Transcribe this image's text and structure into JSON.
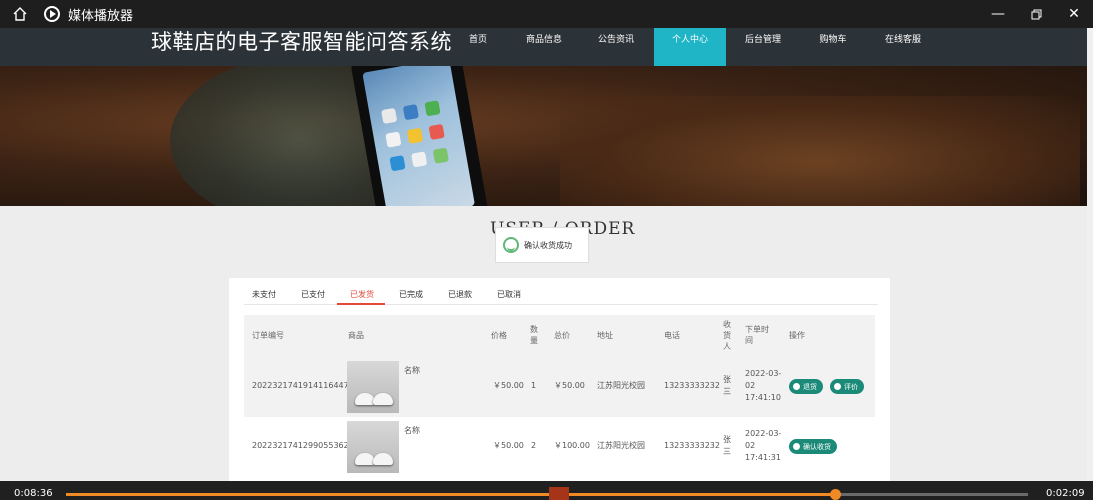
{
  "player": {
    "app_title": "媒体播放器",
    "current_time": "0:08:36",
    "remaining_time": "0:02:09",
    "progress_percent": 79.9
  },
  "site": {
    "title": "球鞋店的电子客服智能问答系统",
    "nav": [
      {
        "label": "首页"
      },
      {
        "label": "商品信息"
      },
      {
        "label": "公告资讯"
      },
      {
        "label": "个人中心"
      },
      {
        "label": "后台管理"
      },
      {
        "label": "购物车"
      },
      {
        "label": "在线客服"
      }
    ],
    "active_nav": "个人中心"
  },
  "toast": {
    "text": "确认收货成功"
  },
  "section_title": "USER / ORDER",
  "tabs": [
    "未支付",
    "已支付",
    "已发货",
    "已完成",
    "已退款",
    "已取消"
  ],
  "active_tab": "已发货",
  "table": {
    "headers": {
      "order_no": "订单编号",
      "goods": "商品",
      "price": "价格",
      "qty": "数量",
      "total": "总价",
      "address": "地址",
      "phone": "电话",
      "receiver": "收货人",
      "time": "下单时间",
      "action": "操作"
    },
    "rows": [
      {
        "order_no": "2022321741914116447",
        "goods_name": "名称",
        "price": "￥50.00",
        "qty": "1",
        "total": "￥50.00",
        "address": "江苏阳光校园",
        "phone": "13233333232",
        "receiver": "张三",
        "time": "2022-03-02 17:41:10",
        "actions": [
          "退货",
          "评价"
        ]
      },
      {
        "order_no": "2022321741299055362 3",
        "goods_name": "名称",
        "price": "￥50.00",
        "qty": "2",
        "total": "￥100.00",
        "address": "江苏阳光校园",
        "phone": "13233333232",
        "receiver": "张三",
        "time": "2022-03-02 17:41:31",
        "actions": [
          "确认收货"
        ]
      }
    ]
  },
  "colors": {
    "accent": "#1fb5c6",
    "navbar": "#2c3338",
    "button": "#1b8a78",
    "active_tab": "#e2493b",
    "progress": "#f08a24"
  }
}
